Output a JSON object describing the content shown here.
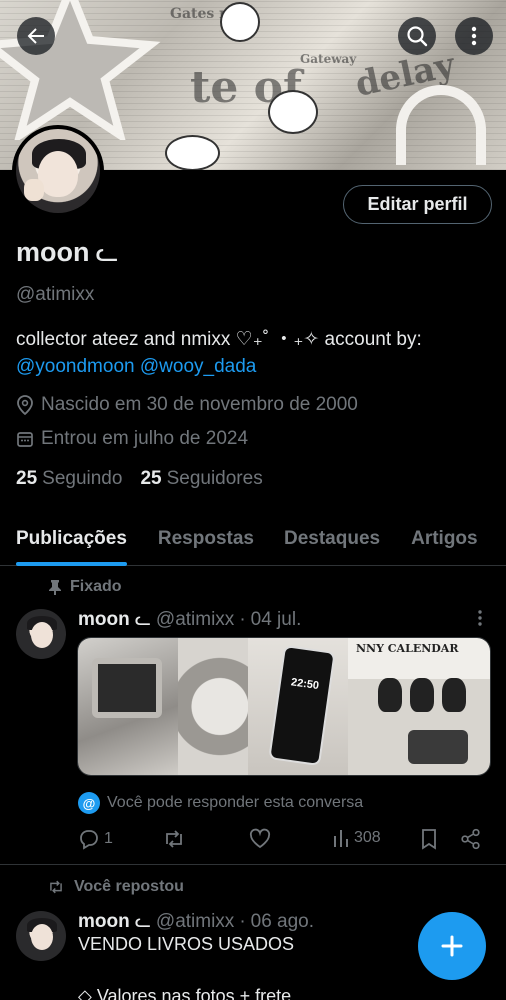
{
  "profile": {
    "display_name": "moon",
    "name_glyph": "ᓚ",
    "handle": "@atimixx",
    "edit_label": "Editar perfil",
    "bio_text": "collector ateez and nmixx ♡₊˚ ・₊✧ account by:",
    "bio_link1": "@yoondmoon",
    "bio_link2": "@wooy_dada",
    "birth": "Nascido em 30 de novembro de 2000",
    "joined": "Entrou em julho de 2024",
    "following_count": "25",
    "following_label": "Seguindo",
    "followers_count": "25",
    "followers_label": "Seguidores"
  },
  "banner": {
    "text_gates": "Gates r",
    "text_te_of": "te of",
    "text_delay": "delay",
    "text_gateway": "Gateway"
  },
  "tabs": [
    {
      "label": "Publicações",
      "active": true
    },
    {
      "label": "Respostas",
      "active": false
    },
    {
      "label": "Destaques",
      "active": false
    },
    {
      "label": "Artigos",
      "active": false
    }
  ],
  "post1": {
    "context": "Fixado",
    "name": "moon",
    "handle": "@atimixx",
    "sep": "·",
    "date": "04 jul.",
    "phone_time": "22:50",
    "calendar_text": "NNY CALENDAR",
    "reply_note": "Você pode responder esta conversa",
    "replies": "1",
    "views": "308"
  },
  "post2": {
    "context": "Você repostou",
    "name": "moon",
    "handle": "@atimixx",
    "sep": "·",
    "date": "06 ago.",
    "text": "VENDO LIVROS USADOS",
    "text2": "◇ Valores nas fotos + frete"
  },
  "colors": {
    "accent": "#1d9bf0",
    "background": "#000000",
    "muted": "#71767b",
    "text": "#e7e9ea"
  }
}
